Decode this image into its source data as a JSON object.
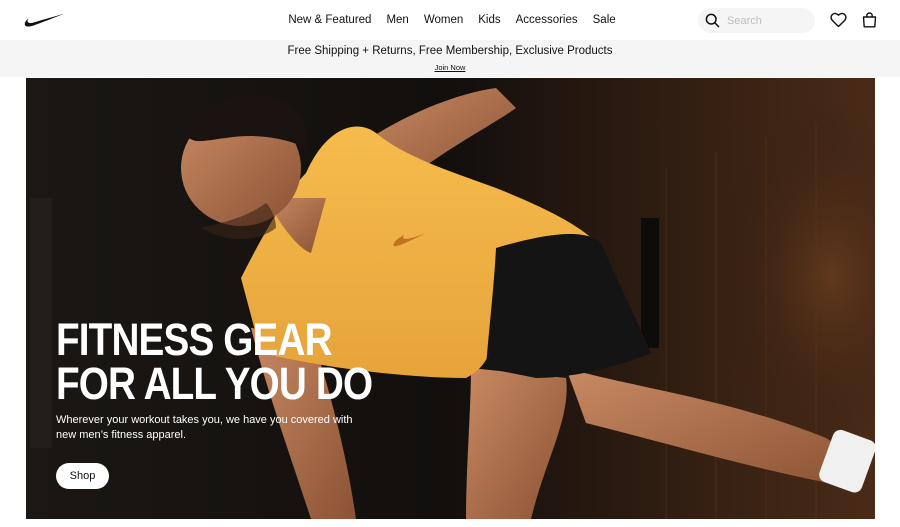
{
  "header": {
    "logo": "nike-swoosh-logo",
    "nav": [
      "New & Featured",
      "Men",
      "Women",
      "Kids",
      "Accessories",
      "Sale"
    ],
    "search": {
      "placeholder": "Search",
      "value": ""
    },
    "icons": {
      "search": "search-icon",
      "favorites": "heart-icon",
      "bag": "bag-icon"
    }
  },
  "promo": {
    "text": "Free Shipping + Returns, Free Membership, Exclusive Products",
    "link": "Join Now"
  },
  "hero": {
    "headline_line1": "FITNESS GEAR",
    "headline_line2": "FOR ALL YOU DO",
    "subtext": "Wherever your workout takes you, we have you covered with new men’s fitness apparel.",
    "cta": "Shop"
  },
  "colors": {
    "tank": "#f2b347",
    "shorts": "#141414",
    "background_dark": "#161210",
    "promo_bg": "#f5f5f5"
  }
}
